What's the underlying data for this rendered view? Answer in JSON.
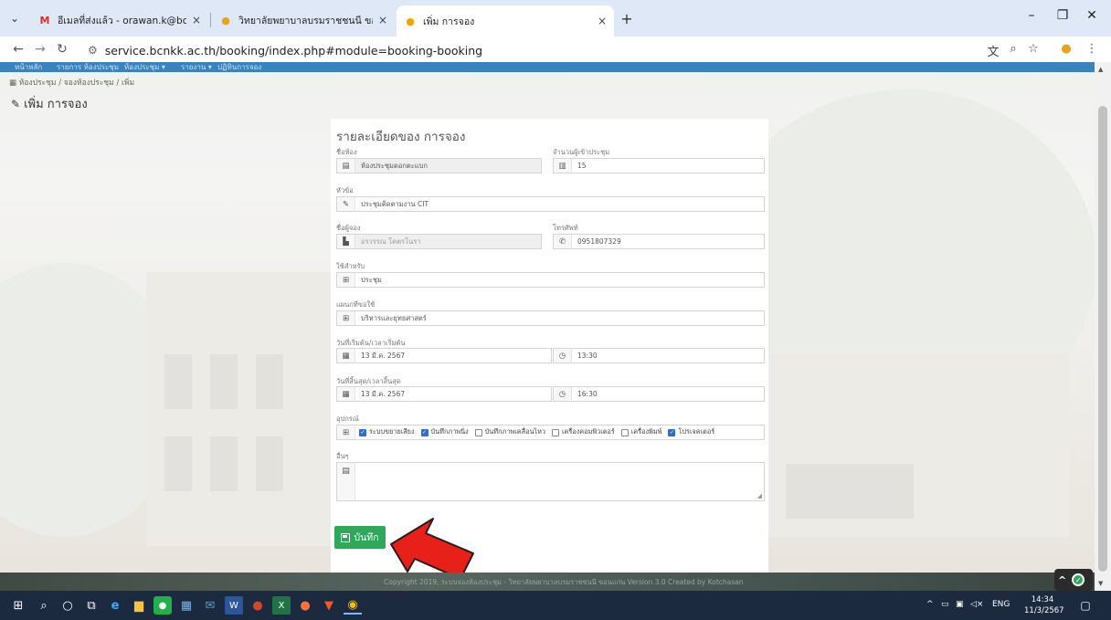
{
  "browser": {
    "tabs": [
      {
        "title": "อีเมลที่ส่งแล้ว - orawan.k@bcnkk.ac.th",
        "icon": "M",
        "close": "×"
      },
      {
        "title": "วิทยาลัยพยาบาลบรมราชชนนี ขอนแก่น",
        "icon": "●",
        "close": "×"
      },
      {
        "title": "เพิ่ม การจอง",
        "icon": "●",
        "close": "×"
      }
    ],
    "new_tab": "+",
    "url": "service.bcnkk.ac.th/booking/index.php#module=booking-booking",
    "window_controls": {
      "minimize": "–",
      "restore": "❐",
      "close": "✕"
    }
  },
  "site": {
    "nav_items": [
      "หน้าหลัก",
      "รายการ ห้องประชุม",
      "ห้องประชุม ▾",
      "รายงาน ▾",
      "ปฏิทินการจอง"
    ],
    "breadcrumb": "ห้องประชุม / จองห้องประชุม / เพิ่ม",
    "page_title": "เพิ่ม การจอง"
  },
  "form": {
    "title": "รายละเอียดของ การจอง",
    "room": {
      "label": "ชื่อห้อง",
      "value": "ห้องประชุมดอกตะแบก"
    },
    "attendees": {
      "label": "จำนวนผู้เข้าประชุม",
      "value": "15"
    },
    "topic": {
      "label": "หัวข้อ",
      "value": "ประชุมติดตามงาน CIT"
    },
    "booker": {
      "label": "ชื่อผู้จอง",
      "value": "อรวรรณ โคตรโนรา"
    },
    "phone": {
      "label": "โทรศัพท์",
      "value": "0951807329"
    },
    "used_for": {
      "label": "ใช้สำหรับ",
      "value": "ประชุม"
    },
    "department": {
      "label": "แผนกที่ขอใช้",
      "value": "บริหารและยุทธศาสตร์"
    },
    "start": {
      "label": "วันที่เริ่มต้น/เวลาเริ่มต้น",
      "date": "13 มี.ค. 2567",
      "time": "13:30"
    },
    "end": {
      "label": "วันที่สิ้นสุด/เวลาสิ้นสุด",
      "date": "13 มี.ค. 2567",
      "time": "16:30"
    },
    "equipment": {
      "label": "อุปกรณ์",
      "items": [
        {
          "label": "ระบบขยายเสียง",
          "checked": true
        },
        {
          "label": "บันทึกภาพนิ่ง",
          "checked": true
        },
        {
          "label": "บันทึกภาพเคลื่อนไหว",
          "checked": false
        },
        {
          "label": "เครื่องคอมพิวเตอร์",
          "checked": false
        },
        {
          "label": "เครื่องพิมพ์",
          "checked": false
        },
        {
          "label": "โปรเจคเตอร์",
          "checked": true
        }
      ]
    },
    "other": {
      "label": "อื่นๆ",
      "value": ""
    },
    "save_label": "บันทึก"
  },
  "footer_text": "Copyright 2019, ระบบจองห้องประชุม - วิทยาลัยพยาบาลบรมราชชนนี ขอนแก่น Version 3.0 Created by Kotchasan",
  "taskbar": {
    "lang": "ENG",
    "time": "14:34",
    "date": "11/3/2567"
  },
  "colors": {
    "nav_blue": "#3a83bf",
    "save_green": "#2fa85a",
    "arrow_red": "#e8201a",
    "taskbar": "#1b2a3f"
  }
}
